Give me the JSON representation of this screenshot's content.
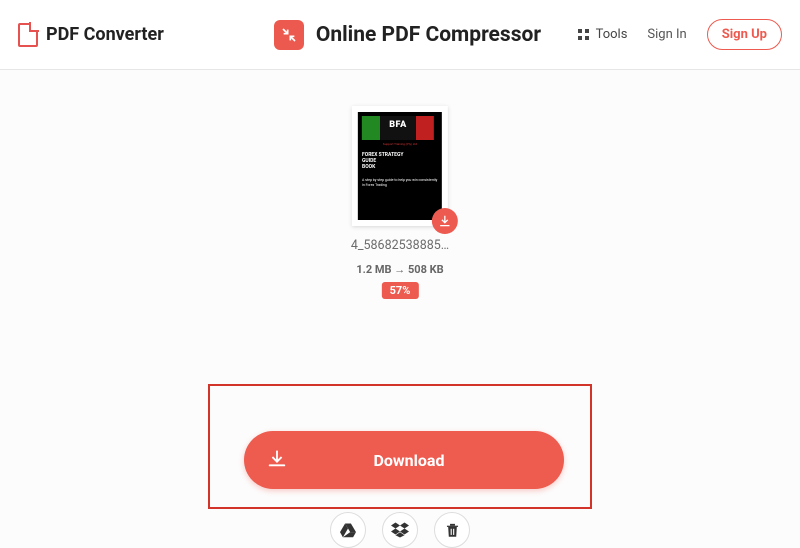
{
  "header": {
    "brand": "PDF Converter",
    "title": "Online PDF Compressor",
    "tools_label": "Tools",
    "signin_label": "Sign In",
    "signup_label": "Sign Up"
  },
  "file": {
    "thumb": {
      "logo_text": "BFA",
      "logo_sub": "Support Training (Pty) Ltd",
      "heading_l1": "FOREX STRATEGY",
      "heading_l2": "GUIDE",
      "heading_l3": "BOOK",
      "blurb": "A step by step guide to help you win consistently in Forex Trading"
    },
    "name": "4_58682538885…",
    "size_before": "1.2 MB",
    "size_arrow": "→",
    "size_after": "508 KB",
    "reduction_percent": "57%"
  },
  "actions": {
    "download_label": "Download",
    "gdrive": "google-drive",
    "dropbox": "dropbox",
    "delete": "delete"
  },
  "colors": {
    "accent": "#ee5b4f"
  }
}
